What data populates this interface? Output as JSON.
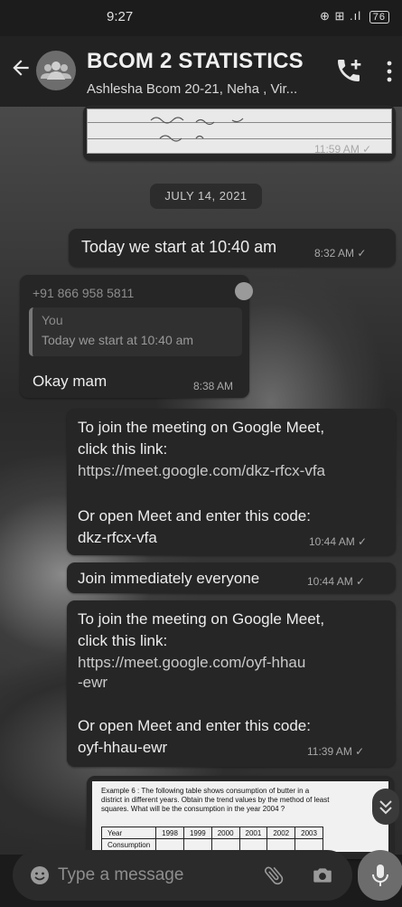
{
  "status_bar": {
    "time": "9:27",
    "icons": "⊕ ⊞ .ıl",
    "battery": "76"
  },
  "header": {
    "title": "BCOM 2 STATISTICS",
    "subtitle": "Ashlesha Bcom 20-21, Neha , Vir..."
  },
  "messages": {
    "image_top_time": "11:59 AM",
    "date_chip": "JULY 14, 2021",
    "m1": {
      "text": "Today we start at 10:40 am",
      "time": "8:32 AM"
    },
    "m2": {
      "sender": "+91 866 958 5811",
      "quote_author": "You",
      "quote_text": "Today we start at 10:40 am",
      "text": "Okay mam",
      "time": "8:38 AM"
    },
    "m3": {
      "line1": "To join the meeting on Google Meet,",
      "line2": "click this link:",
      "link": "https://meet.google.com/dkz-rfcx-vfa",
      "line3": "Or open Meet and enter this code:",
      "code": "dkz-rfcx-vfa",
      "time": "10:44 AM"
    },
    "m4": {
      "text": "Join immediately everyone",
      "time": "10:44 AM"
    },
    "m5": {
      "line1": "To join the meeting on Google Meet,",
      "line2": "click this link:",
      "link1": "https://meet.google.com/oyf-hhau",
      "link2": "-ewr",
      "line3": "Or open Meet and enter this code:",
      "code": "oyf-hhau-ewr",
      "time": "11:39 AM"
    },
    "doc": {
      "line1": "Example 6 : The following table shows consumption of butter in a",
      "line2": "district in different years. Obtain the trend values by the method of least",
      "line3": "squares. What will be the consumption in the year 2004 ?",
      "table_header": [
        "Year",
        "1998",
        "1999",
        "2000",
        "2001",
        "2002",
        "2003"
      ],
      "row2_label": "Consumption"
    }
  },
  "input": {
    "placeholder": "Type a message"
  },
  "colors": {
    "bubble": "#262626",
    "header": "#222222"
  },
  "icons": [
    "back-arrow-icon",
    "group-avatar-icon",
    "add-call-icon",
    "more-vert-icon",
    "emoji-icon",
    "attach-icon",
    "camera-icon",
    "mic-icon",
    "chevron-down-icon"
  ]
}
